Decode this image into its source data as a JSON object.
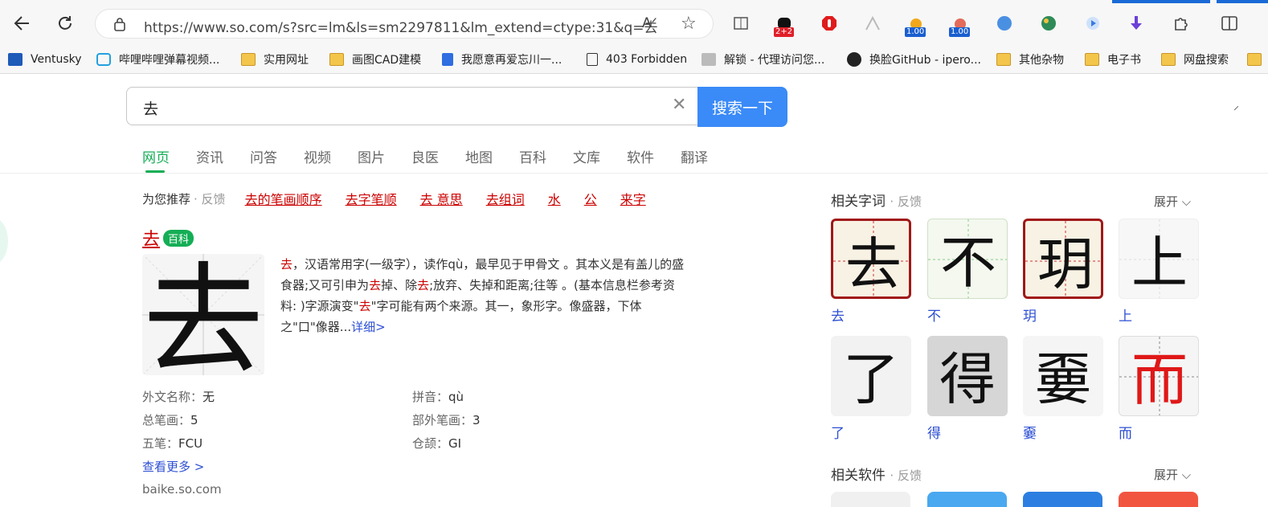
{
  "browser": {
    "url": "https://www.so.com/s?src=lm&ls=sm2297811&lm_extend=ctype:31&q=去",
    "badges": [
      "2+2",
      "1.00",
      "1.00"
    ]
  },
  "bookmarks": [
    {
      "label": "Ventusky",
      "icon": "ventusky-icon"
    },
    {
      "label": "哔哩哔哩弹幕视频...",
      "icon": "bilibili-icon"
    },
    {
      "label": "实用网址",
      "icon": "folder-icon"
    },
    {
      "label": "画图CAD建模",
      "icon": "folder-icon"
    },
    {
      "label": "我愿意再爱忘川一...",
      "icon": "doc-icon"
    },
    {
      "label": "403 Forbidden",
      "icon": "page-icon"
    },
    {
      "label": "解锁 - 代理访问您...",
      "icon": "ub-icon"
    },
    {
      "label": "换脸GitHub - ipero...",
      "icon": "github-icon"
    },
    {
      "label": "其他杂物",
      "icon": "folder-icon"
    },
    {
      "label": "电子书",
      "icon": "folder-icon"
    },
    {
      "label": "网盘搜索",
      "icon": "folder-icon"
    }
  ],
  "search": {
    "query": "去",
    "button": "搜索一下"
  },
  "tabs": [
    "网页",
    "资讯",
    "问答",
    "视频",
    "图片",
    "良医",
    "地图",
    "百科",
    "文库",
    "软件",
    "翻译"
  ],
  "recommend": {
    "label": "为您推荐",
    "feedback": "· 反馈",
    "links": [
      "去的笔画顺序",
      "去字笔顺",
      "去 意思",
      "去组词",
      "水",
      "公",
      "来字"
    ]
  },
  "result": {
    "title": "去",
    "tag": "百科",
    "char": "去",
    "desc_parts": [
      {
        "t": "去",
        "red": true
      },
      {
        "t": "，汉语常用字(一级字），读作qù，最早见于甲骨文 。其本义是有盖儿的盛食器;又可引申为",
        "red": false
      },
      {
        "t": "去",
        "red": true
      },
      {
        "t": "掉、除",
        "red": false
      },
      {
        "t": "去",
        "red": true
      },
      {
        "t": ";放弃、失掉和距离;往等 。(基本信息栏参考资料: )字源演变\"",
        "red": false
      },
      {
        "t": "去",
        "red": true
      },
      {
        "t": "\"字可能有两个来源。其一，象形字。像盛器，下体之\"口\"像器...",
        "red": false
      }
    ],
    "detail_link": "详细>",
    "info": [
      {
        "k": "外文名称：",
        "v": "无"
      },
      {
        "k": "拼音：",
        "v": "qù"
      },
      {
        "k": "总笔画：",
        "v": "5"
      },
      {
        "k": "部外笔画：",
        "v": "3"
      },
      {
        "k": "五笔：",
        "v": "FCU"
      },
      {
        "k": "仓颉：",
        "v": "GI"
      }
    ],
    "more": "查看更多 >",
    "source": "baike.so.com"
  },
  "related_chars": {
    "title": "相关字词",
    "feedback": "· 反馈",
    "expand": "展开",
    "items": [
      {
        "char": "去",
        "label": "去"
      },
      {
        "char": "不",
        "label": "不"
      },
      {
        "char": "玥",
        "label": "玥"
      },
      {
        "char": "上",
        "label": "上"
      },
      {
        "char": "了",
        "label": "了"
      },
      {
        "char": "得",
        "label": "得"
      },
      {
        "char": "嫑",
        "label": "嫑"
      },
      {
        "char": "而",
        "label": "而"
      }
    ]
  },
  "related_software": {
    "title": "相关软件",
    "feedback": "· 反馈",
    "expand": "展开"
  },
  "colors": {
    "accent_green": "#14ae55",
    "link_blue": "#2d4fd3",
    "red": "#cc0000",
    "search_blue": "#3a8af7"
  }
}
